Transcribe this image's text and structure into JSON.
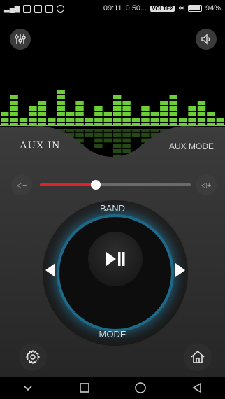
{
  "status_bar": {
    "time": "09:11",
    "speed": "0.50...",
    "volte": "VOLTE2",
    "battery": "94%"
  },
  "header": {
    "equalizer_icon": "equalizer-icon",
    "speaker_icon": "speaker-icon"
  },
  "visualizer": {
    "bar_levels": [
      3,
      6,
      2,
      4,
      5,
      2,
      7,
      3,
      5,
      2,
      4,
      3,
      6,
      5,
      2,
      4,
      3,
      5,
      6,
      2,
      4,
      5,
      3,
      2
    ]
  },
  "source": {
    "label": "AUX IN",
    "mode": "AUX MODE"
  },
  "volume": {
    "down_label": "◁−",
    "up_label": "◁+",
    "level": 0.37
  },
  "wheel": {
    "band_label": "BAND",
    "mode_label": "MODE"
  },
  "colors": {
    "accent_red": "#e0232b",
    "ring_blue": "#2a9fd0",
    "bar_green": "#6ccf3a"
  },
  "bottom": {
    "settings_icon": "gear-icon",
    "home_icon": "home-icon"
  }
}
